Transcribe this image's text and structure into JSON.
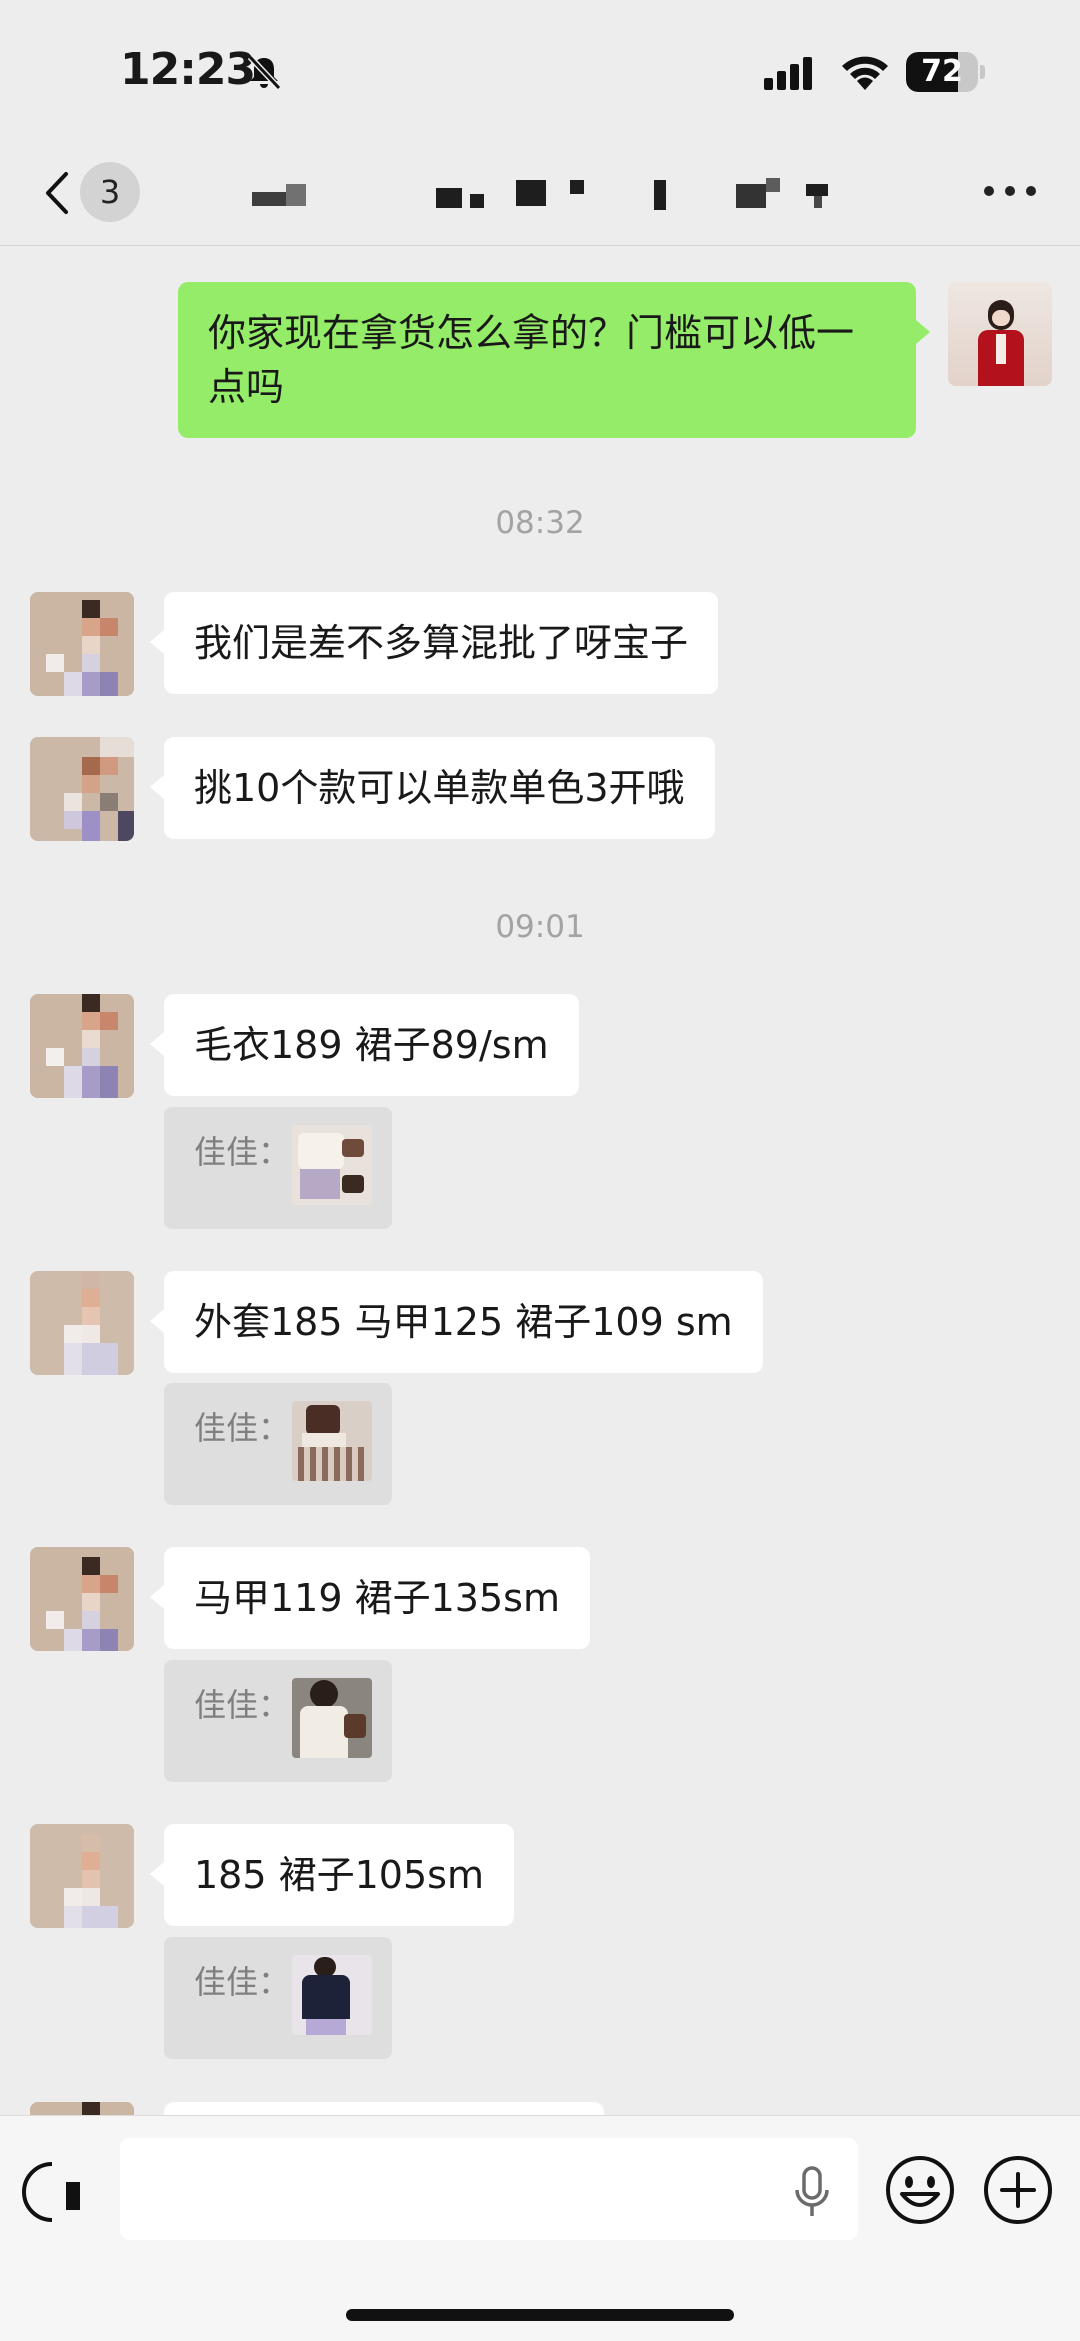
{
  "status_bar": {
    "time": "12:23",
    "battery_level": 72,
    "battery_text": "72"
  },
  "nav": {
    "unread_count": "3",
    "title_redacted": true
  },
  "messages": {
    "outgoing_1": "你家现在拿货怎么拿的？门槛可以低一点吗",
    "timestamp_1": "08:32",
    "incoming_1": "我们是差不多算混批了呀宝子",
    "incoming_2": "挑10个款可以单款单色3开哦",
    "timestamp_2": "09:01",
    "incoming_3": "毛衣189 裙子89/sm",
    "quote_1_name": "佳佳：",
    "incoming_4": "外套185 马甲125 裙子109 sm",
    "quote_2_name": "佳佳：",
    "incoming_5": "马甲119 裙子135sm",
    "quote_3_name": "佳佳：",
    "incoming_6": "185 裙子105sm",
    "quote_4_name": "佳佳："
  },
  "input": {
    "value": "",
    "placeholder": ""
  },
  "icons": {
    "back": "chevron-left-icon",
    "more": "more-icon",
    "voice": "voice-icon",
    "mic": "microphone-icon",
    "emoji": "emoji-icon",
    "plus": "plus-icon"
  },
  "colors": {
    "background": "#ededed",
    "outgoing_bubble": "#95ec69",
    "incoming_bubble": "#ffffff",
    "timestamp": "#a3a3a3"
  }
}
